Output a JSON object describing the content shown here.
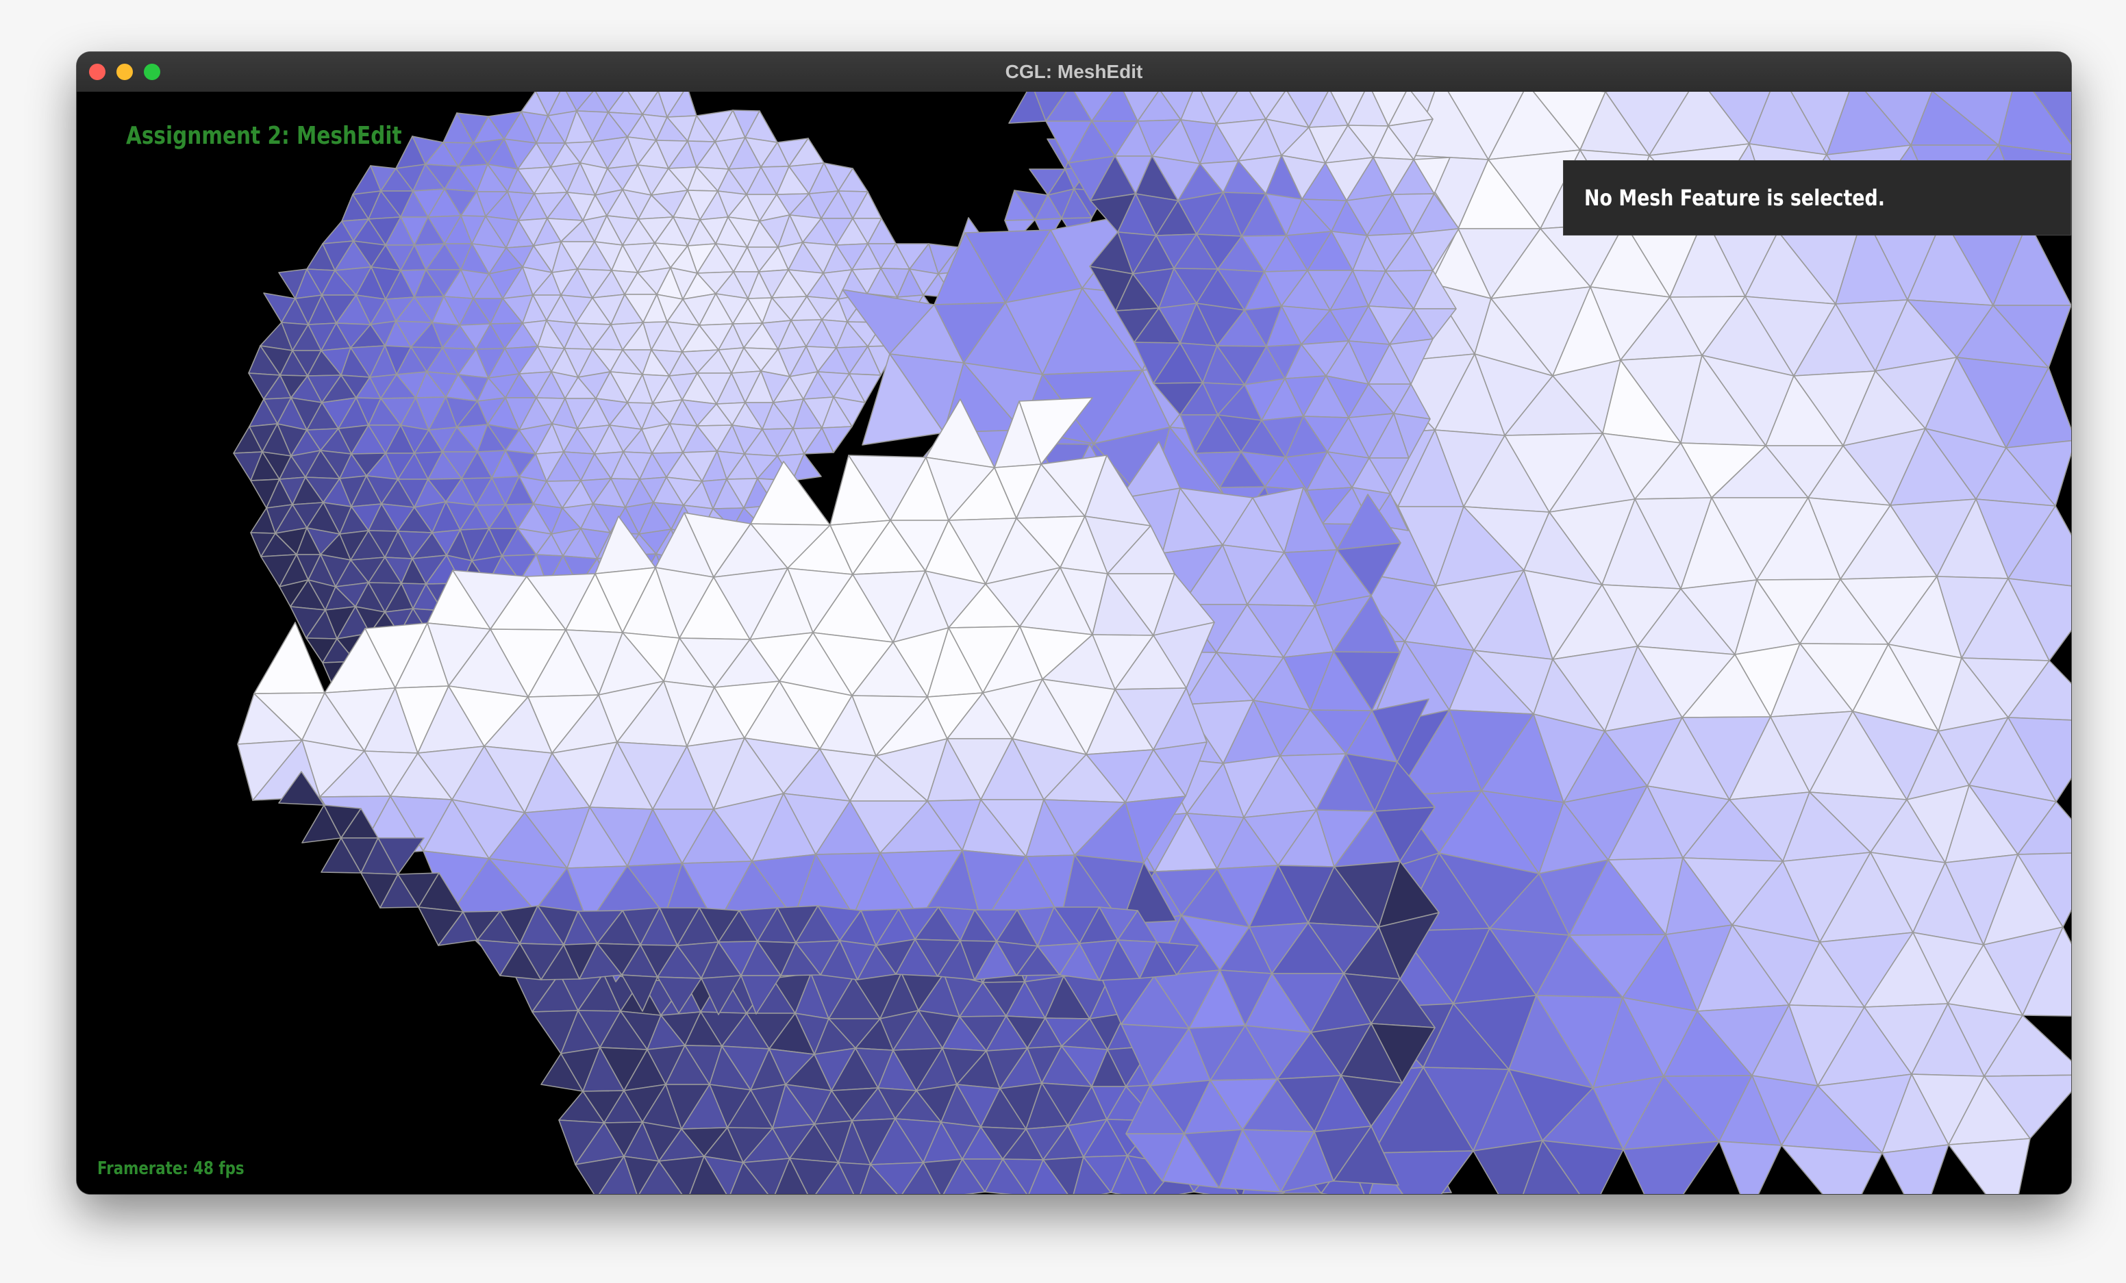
{
  "window": {
    "title": "CGL: MeshEdit"
  },
  "viewport": {
    "assignment_title": "Assignment 2: MeshEdit",
    "framerate": "Framerate: 48 fps",
    "feature_panel_text": "No Mesh Feature is selected."
  },
  "colors": {
    "overlay_text": "#2e8b2e",
    "background": "#000000",
    "mesh_light": "#f3f3ff",
    "mesh_mid": "#9c9cf6",
    "mesh_dark": "#22223f",
    "wire": "#9a9a9a"
  }
}
